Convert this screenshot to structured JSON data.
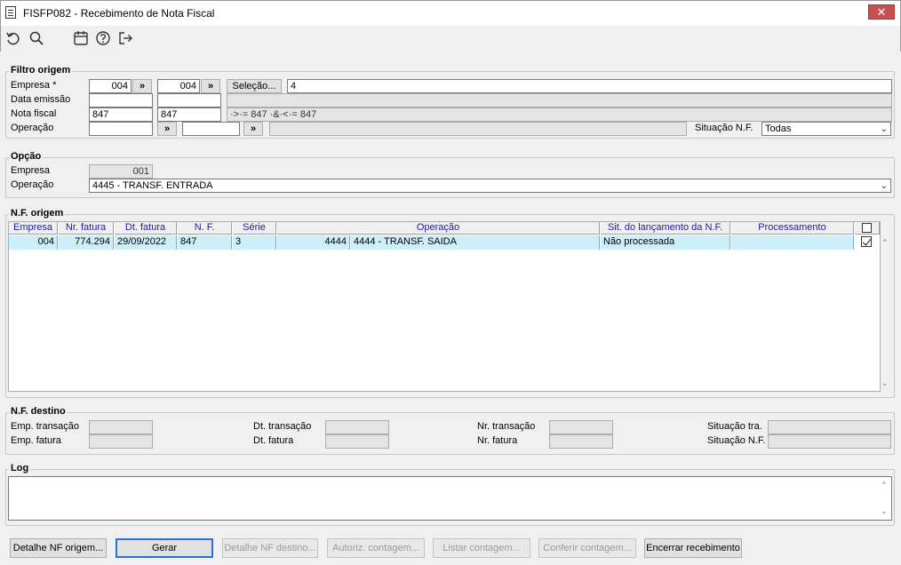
{
  "window": {
    "title": "FISFP082 - Recebimento de Nota Fiscal",
    "close_glyph": "✕"
  },
  "toolbar": {
    "icons": [
      "undo-icon",
      "search-icon",
      "calendar-icon",
      "help-icon",
      "exit-icon"
    ]
  },
  "filtro_origem": {
    "legend": "Filtro origem",
    "empresa_label": "Empresa *",
    "empresa_from": "004",
    "empresa_to": "004",
    "lookup_glyph": "»",
    "selecao_button": "Seleção...",
    "selecao_value": "4",
    "data_emissao_label": "Data emissão",
    "data_emissao_from": "",
    "data_emissao_to": "",
    "data_emissao_expr": "",
    "nota_fiscal_label": "Nota fiscal",
    "nota_fiscal_from": "847",
    "nota_fiscal_to": "847",
    "nota_fiscal_expr": "·>·= 847 ·&·<·= 847",
    "operacao_label": "Operação",
    "operacao_from": "",
    "operacao_to": "",
    "operacao_desc": "",
    "situacao_label": "Situação N.F.",
    "situacao_value": "Todas"
  },
  "opcao": {
    "legend": "Opção",
    "empresa_label": "Empresa",
    "empresa_value": "001",
    "operacao_label": "Operação",
    "operacao_value": "4445 - TRANSF. ENTRADA"
  },
  "nf_origem": {
    "legend": "N.F. origem",
    "columns": [
      "Empresa",
      "Nr. fatura",
      "Dt. fatura",
      "N. F.",
      "Série",
      "Operação",
      "Sit. do lançamento da N.F.",
      "Processamento"
    ],
    "rows": [
      {
        "empresa": "004",
        "nr_fatura": "774.294",
        "dt_fatura": "29/09/2022",
        "nf": "847",
        "serie": "3",
        "operacao_code": "4444",
        "operacao_desc": "4444 - TRANSF. SAIDA",
        "situacao": "Não processada",
        "processamento": "",
        "checked": true
      }
    ]
  },
  "nf_destino": {
    "legend": "N.F. destino",
    "emp_transacao_label": "Emp. transação",
    "emp_fatura_label": "Emp. fatura",
    "dt_transacao_label": "Dt. transação",
    "dt_fatura_label": "Dt. fatura",
    "nr_transacao_label": "Nr. transação",
    "nr_fatura_label": "Nr. fatura",
    "situacao_tra_label": "Situação tra.",
    "situacao_nf_label": "Situação N.F."
  },
  "log": {
    "legend": "Log",
    "text": ""
  },
  "buttons": {
    "detalhe_origem": "Detalhe NF origem...",
    "gerar": "Gerar",
    "detalhe_destino": "Detalhe NF destino...",
    "autoriz": "Autoriz. contagem...",
    "listar": "Listar contagem...",
    "conferir": "Conferir contagem...",
    "encerrar": "Encerrar recebimento"
  },
  "scroll": {
    "up": "⌃",
    "down": "⌄"
  }
}
